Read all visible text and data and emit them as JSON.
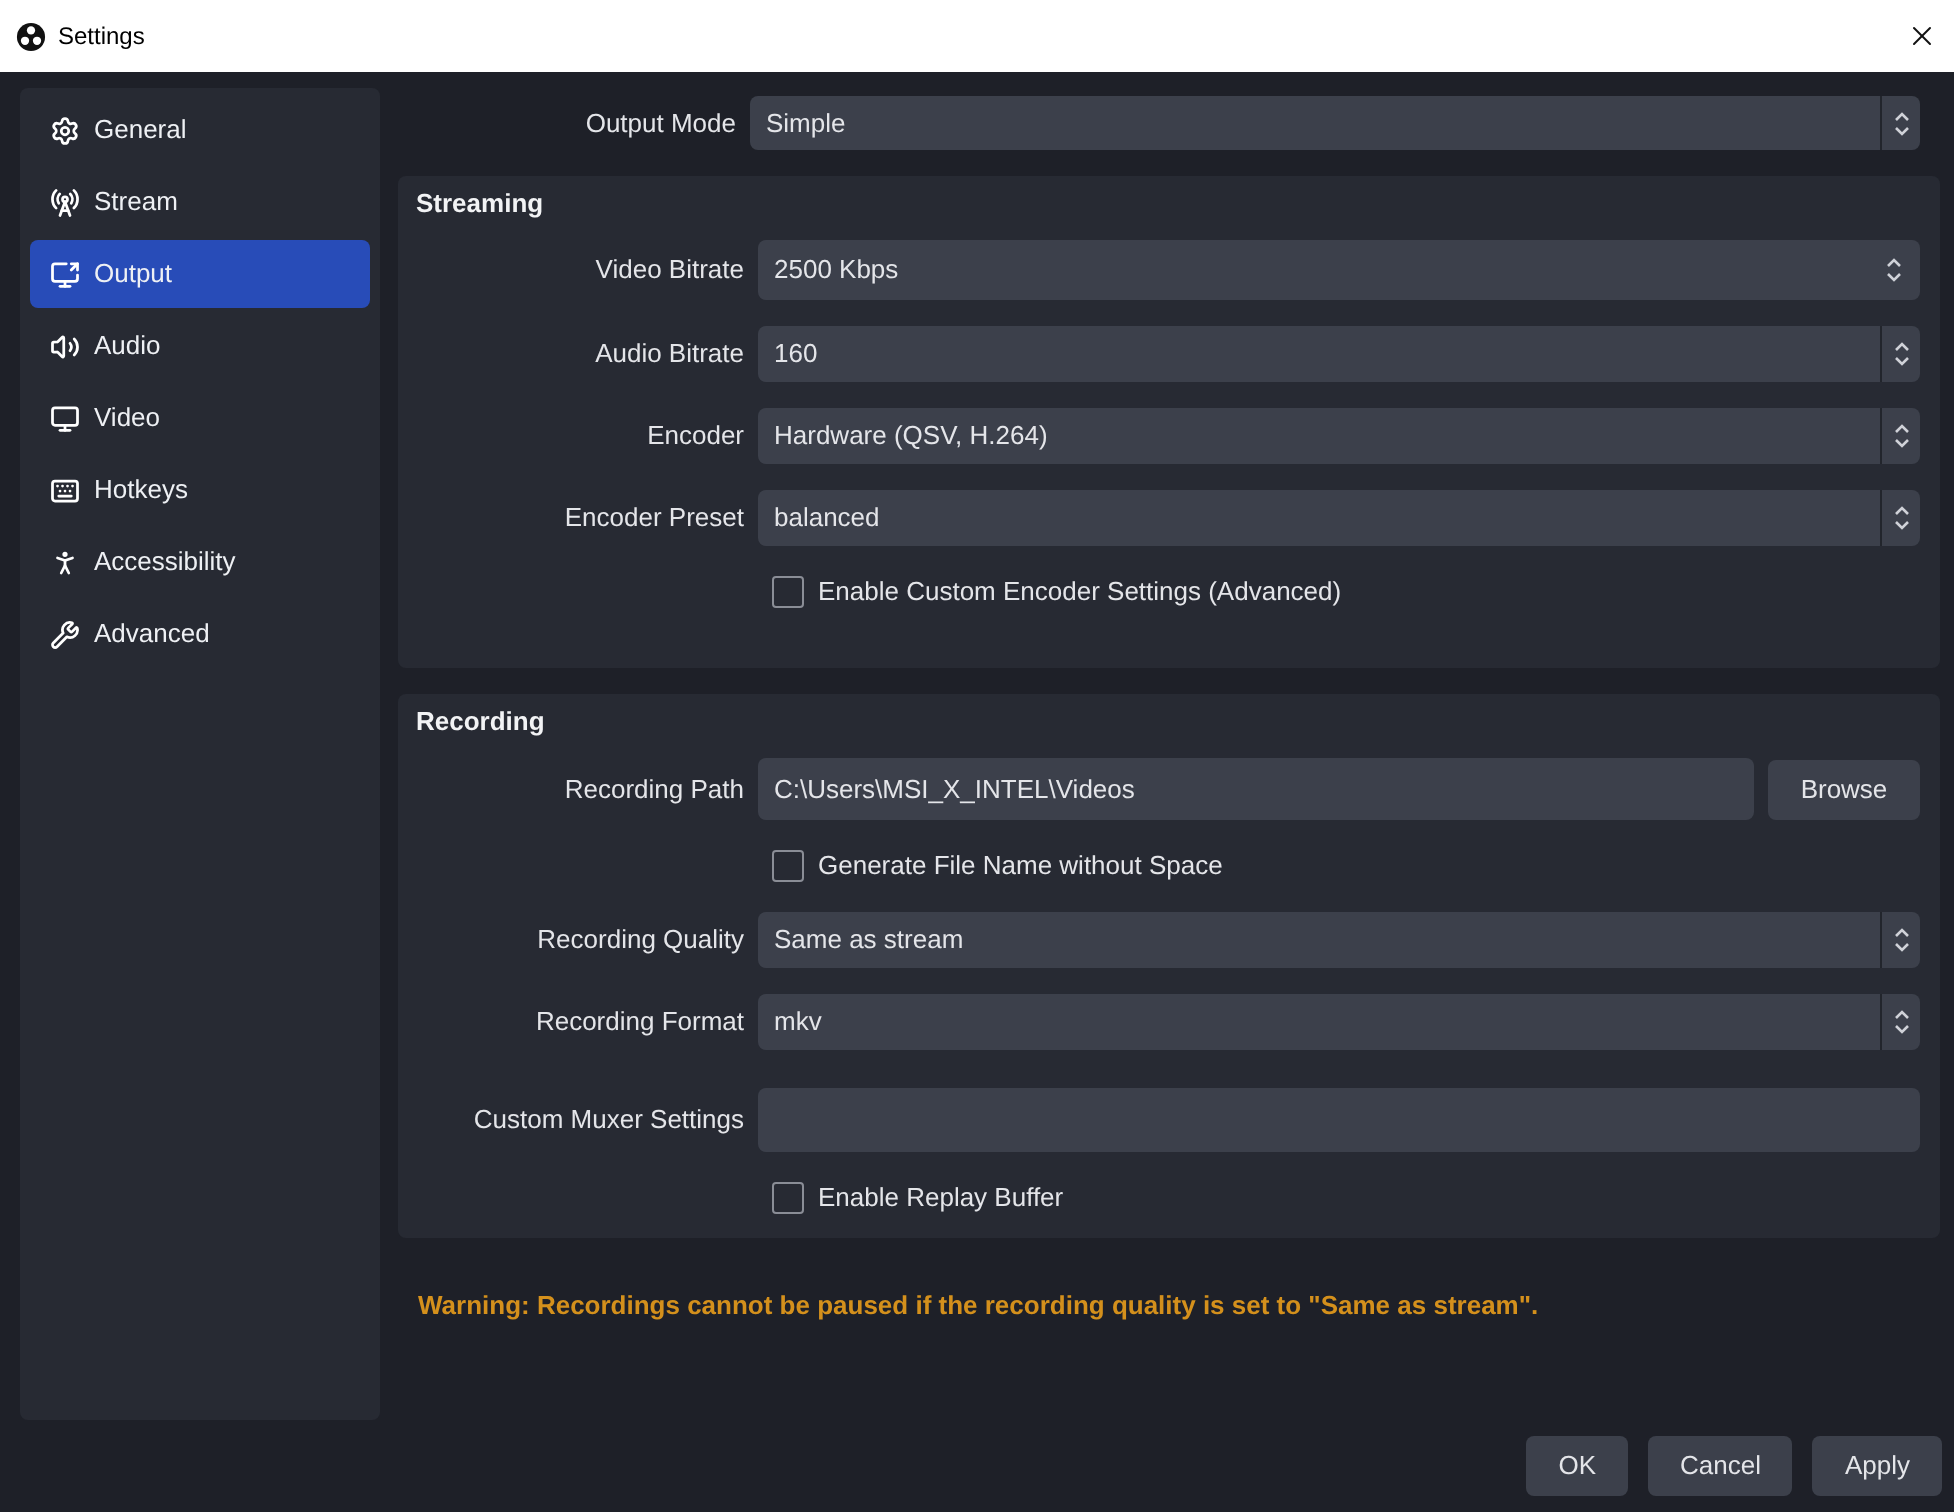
{
  "window": {
    "title": "Settings"
  },
  "sidebar": {
    "items": [
      {
        "label": "General",
        "selected": false
      },
      {
        "label": "Stream",
        "selected": false
      },
      {
        "label": "Output",
        "selected": true
      },
      {
        "label": "Audio",
        "selected": false
      },
      {
        "label": "Video",
        "selected": false
      },
      {
        "label": "Hotkeys",
        "selected": false
      },
      {
        "label": "Accessibility",
        "selected": false
      },
      {
        "label": "Advanced",
        "selected": false
      }
    ]
  },
  "output_mode": {
    "label": "Output Mode",
    "value": "Simple"
  },
  "sections": [
    {
      "title": "Streaming",
      "rows": [
        {
          "kind": "spinbox",
          "label": "Video Bitrate",
          "value": "2500 Kbps"
        },
        {
          "kind": "dropdown",
          "label": "Audio Bitrate",
          "value": "160"
        },
        {
          "kind": "dropdown",
          "label": "Encoder",
          "value": "Hardware (QSV, H.264)"
        },
        {
          "kind": "dropdown",
          "label": "Encoder Preset",
          "value": "balanced"
        },
        {
          "kind": "checkbox",
          "label": "Enable Custom Encoder Settings (Advanced)",
          "checked": false
        }
      ]
    },
    {
      "title": "Recording",
      "rows": [
        {
          "kind": "path",
          "label": "Recording Path",
          "value": "C:\\Users\\MSI_X_INTEL\\Videos",
          "button": "Browse"
        },
        {
          "kind": "checkbox",
          "label": "Generate File Name without Space",
          "checked": false
        },
        {
          "kind": "dropdown",
          "label": "Recording Quality",
          "value": "Same as stream"
        },
        {
          "kind": "dropdown",
          "label": "Recording Format",
          "value": "mkv"
        },
        {
          "kind": "text",
          "label": "Custom Muxer Settings",
          "value": ""
        },
        {
          "kind": "checkbox",
          "label": "Enable Replay Buffer",
          "checked": false
        }
      ]
    }
  ],
  "warning": "Warning: Recordings cannot be paused if the recording quality is set to \"Same as stream\".",
  "buttons": [
    "OK",
    "Cancel",
    "Apply"
  ]
}
